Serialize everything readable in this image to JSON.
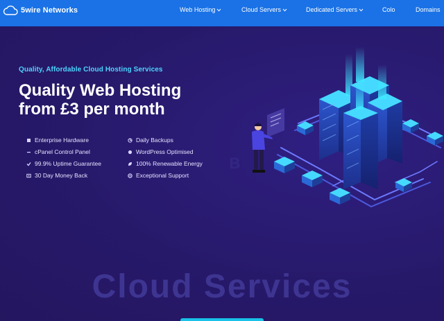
{
  "brand": {
    "name": "5wire Networks",
    "icon": "cloud-icon"
  },
  "nav": {
    "items": [
      {
        "label": "Web Hosting",
        "dropdown": true
      },
      {
        "label": "Cloud Servers",
        "dropdown": true
      },
      {
        "label": "Dedicated Servers",
        "dropdown": true
      },
      {
        "label": "Colo",
        "dropdown": false
      },
      {
        "label": "Domains",
        "dropdown": false
      }
    ]
  },
  "hero": {
    "kicker": "Quality, Affordable Cloud Hosting Services",
    "headline_line1": "Quality Web Hosting",
    "headline_line2": "from £3 per month",
    "features_left": [
      {
        "label": "Enterprise Hardware",
        "icon": "server-icon"
      },
      {
        "label": "cPanel Control Panel",
        "icon": "cpanel-icon"
      },
      {
        "label": "99.9% Uptime Guarantee",
        "icon": "check-icon"
      },
      {
        "label": "30 Day Money Back",
        "icon": "money-icon"
      }
    ],
    "features_right": [
      {
        "label": "Daily Backups",
        "icon": "backup-icon"
      },
      {
        "label": "WordPress Optimised",
        "icon": "wordpress-icon"
      },
      {
        "label": "100% Renewable Energy",
        "icon": "leaf-icon"
      },
      {
        "label": "Exceptional Support",
        "icon": "support-icon"
      }
    ]
  },
  "section": {
    "watermark": "Cloud Services"
  },
  "colors": {
    "nav_bg": "#1a72e6",
    "hero_bg": "#2a1b6e",
    "accent": "#4fd4ff"
  }
}
